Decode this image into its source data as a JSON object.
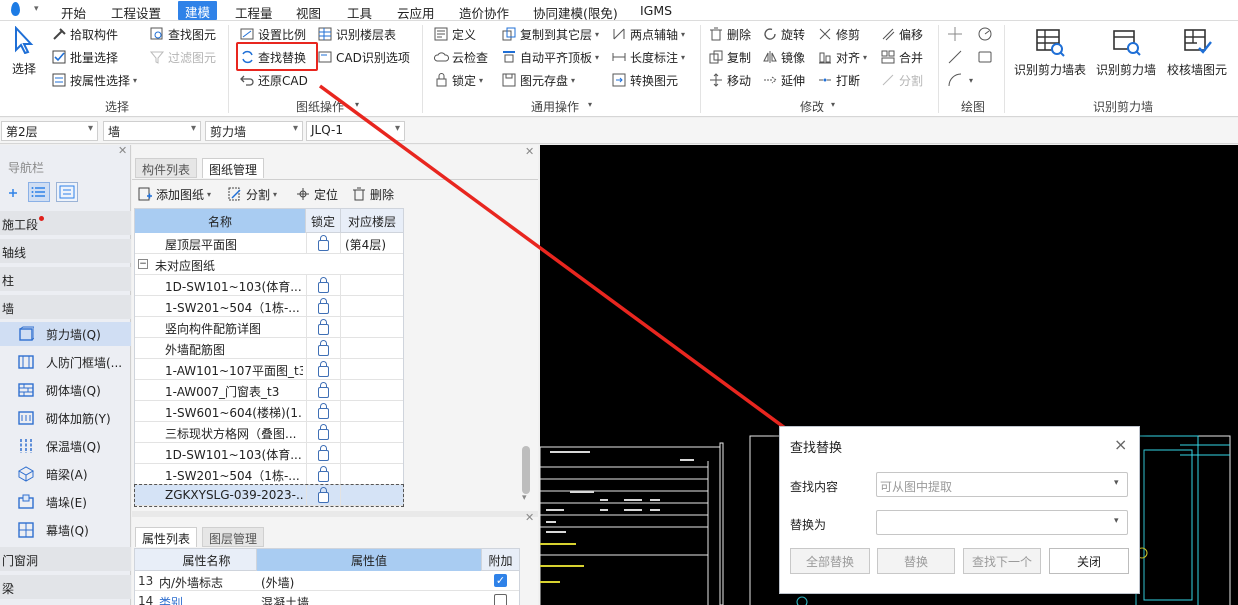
{
  "menu": [
    "开始",
    "工程设置",
    "建模",
    "工程量",
    "视图",
    "工具",
    "云应用",
    "造价协作",
    "协同建模(限免)",
    "IGMS"
  ],
  "ribbon": {
    "select_group": {
      "big": "选择",
      "items": [
        "拾取构件",
        "批量选择",
        "按属性选择"
      ],
      "label": "选择"
    },
    "drawing_ops": {
      "items": [
        "查找图元",
        "过滤图元",
        "设置比例",
        "查找替换",
        "还原CAD",
        "识别楼层表",
        "CAD识别选项"
      ],
      "label": "图纸操作"
    },
    "general_ops": {
      "items": [
        "定义",
        "云检查",
        "锁定",
        "复制到其它层",
        "自动平齐顶板",
        "图元存盘",
        "两点辅轴",
        "长度标注",
        "转换图元"
      ],
      "label": "通用操作"
    },
    "modify": {
      "items": [
        "删除",
        "旋转",
        "修剪",
        "偏移",
        "复制",
        "镜像",
        "对齐",
        "合并",
        "移动",
        "延伸",
        "打断",
        "分割"
      ],
      "label": "修改"
    },
    "draw": {
      "label": "绘图"
    },
    "recog": {
      "items": [
        "识别剪力墙表",
        "识别剪力墙",
        "校核墙图元"
      ],
      "label": "识别剪力墙"
    }
  },
  "selectors": [
    "第2层",
    "墙",
    "剪力墙",
    "JLQ-1"
  ],
  "nav": {
    "title": "导航栏",
    "cats": [
      "施工段",
      "轴线",
      "柱",
      "墙",
      "门窗洞",
      "梁"
    ],
    "wall_items": [
      "剪力墙(Q)",
      "人防门框墙(...",
      "砌体墙(Q)",
      "砌体加筋(Y)",
      "保温墙(Q)",
      "暗梁(A)",
      "墙垛(E)",
      "幕墙(Q)"
    ]
  },
  "drawings": {
    "tabs": [
      "构件列表",
      "图纸管理"
    ],
    "toolbar": [
      "添加图纸",
      "分割",
      "定位",
      "删除"
    ],
    "headers": [
      "名称",
      "锁定",
      "对应楼层"
    ],
    "rows": [
      {
        "name": "屋顶层平面图",
        "floor": "(第4层)"
      },
      {
        "name": "未对应图纸",
        "group": true
      },
      {
        "name": "1D-SW101~103(体育..."
      },
      {
        "name": "1-SW201~504（1栋-..."
      },
      {
        "name": "竖向构件配筋详图"
      },
      {
        "name": "外墙配筋图"
      },
      {
        "name": "1-AW101~107平面图_t3"
      },
      {
        "name": "1-AW007_门窗表_t3"
      },
      {
        "name": "1-SW601~604(楼梯)(1..."
      },
      {
        "name": "三标现状方格网（叠图..."
      },
      {
        "name": "1D-SW101~103(体育..."
      },
      {
        "name": "1-SW201~504（1栋-..."
      },
      {
        "name": "ZGKXYSLG-039-2023-...",
        "selected": true
      }
    ]
  },
  "props": {
    "tabs": [
      "属性列表",
      "图层管理"
    ],
    "headers": [
      "属性名称",
      "属性值",
      "附加"
    ],
    "rows": [
      {
        "no": "13",
        "name": "内/外墙标志",
        "value": "(外墙)",
        "checked": true
      },
      {
        "no": "14",
        "name": "类别",
        "value": "混凝土墙",
        "checked": false
      }
    ]
  },
  "dialog": {
    "title": "查找替换",
    "find_label": "查找内容",
    "find_placeholder": "可从图中提取",
    "replace_label": "替换为",
    "buttons": [
      "全部替换",
      "替换",
      "查找下一个",
      "关闭"
    ]
  },
  "colors": {
    "accent": "#2f82e8",
    "highlight_box": "#e8261f",
    "arrow": "#e8261f"
  }
}
